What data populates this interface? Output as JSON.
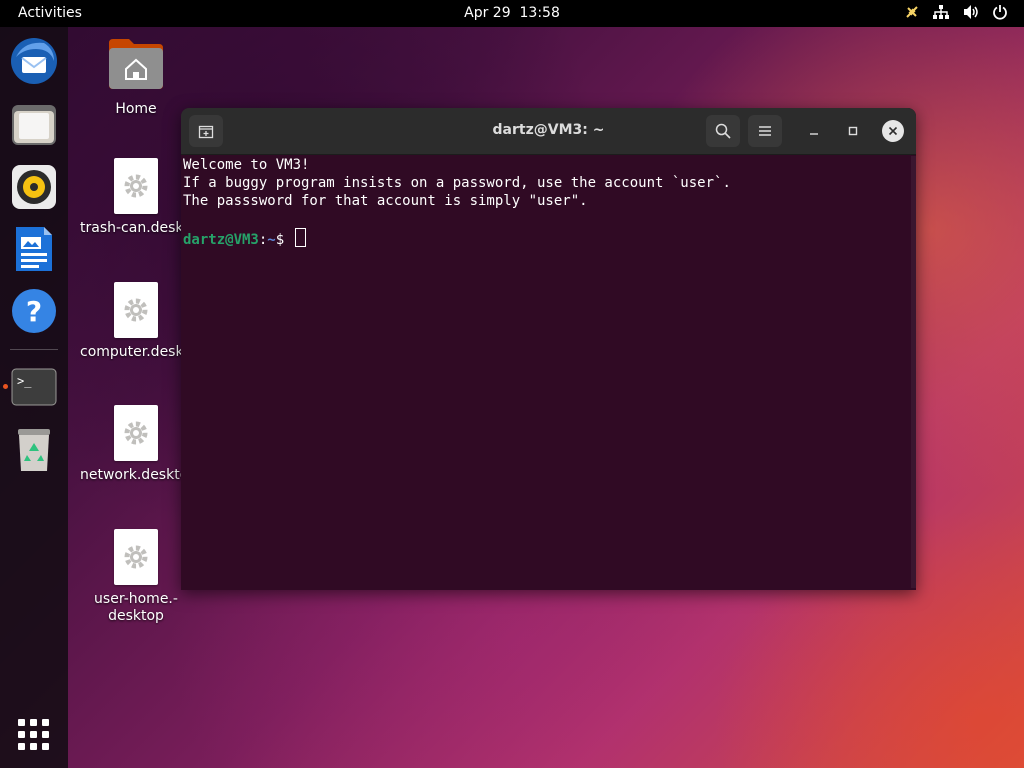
{
  "topbar": {
    "activities": "Activities",
    "date": "Apr 29",
    "time": "13:58"
  },
  "dock": {
    "items": [
      {
        "name": "Thunderbird Mail",
        "icon": "thunderbird-icon"
      },
      {
        "name": "Files",
        "icon": "files-icon"
      },
      {
        "name": "Rhythmbox",
        "icon": "rhythmbox-icon"
      },
      {
        "name": "LibreOffice Writer",
        "icon": "writer-icon"
      },
      {
        "name": "Help",
        "icon": "help-icon"
      },
      {
        "name": "Terminal",
        "icon": "terminal-icon",
        "running": true
      },
      {
        "name": "Trash",
        "icon": "trash-icon"
      },
      {
        "name": "Show Applications",
        "icon": "app-grid-icon"
      }
    ]
  },
  "desktop": {
    "icons": [
      {
        "label": "Home"
      },
      {
        "label": "trash-can.desktop"
      },
      {
        "label": "computer.desktop"
      },
      {
        "label": "network.desktop"
      },
      {
        "label": "user-home.-\ndesktop"
      }
    ]
  },
  "terminal": {
    "title": "dartz@VM3: ~",
    "lines": [
      "Welcome to VM3!",
      "If a buggy program insists on a password, use the account `user`.",
      "The passsword for that account is simply \"user\"."
    ],
    "prompt_user": "dartz@VM3",
    "prompt_sep": ":",
    "prompt_path": "~",
    "prompt_symbol": "$ "
  },
  "colors": {
    "accent": "#e95420",
    "terminal_bg": "#300a24",
    "prompt_user": "#26a269",
    "prompt_path": "#5f87d7"
  }
}
